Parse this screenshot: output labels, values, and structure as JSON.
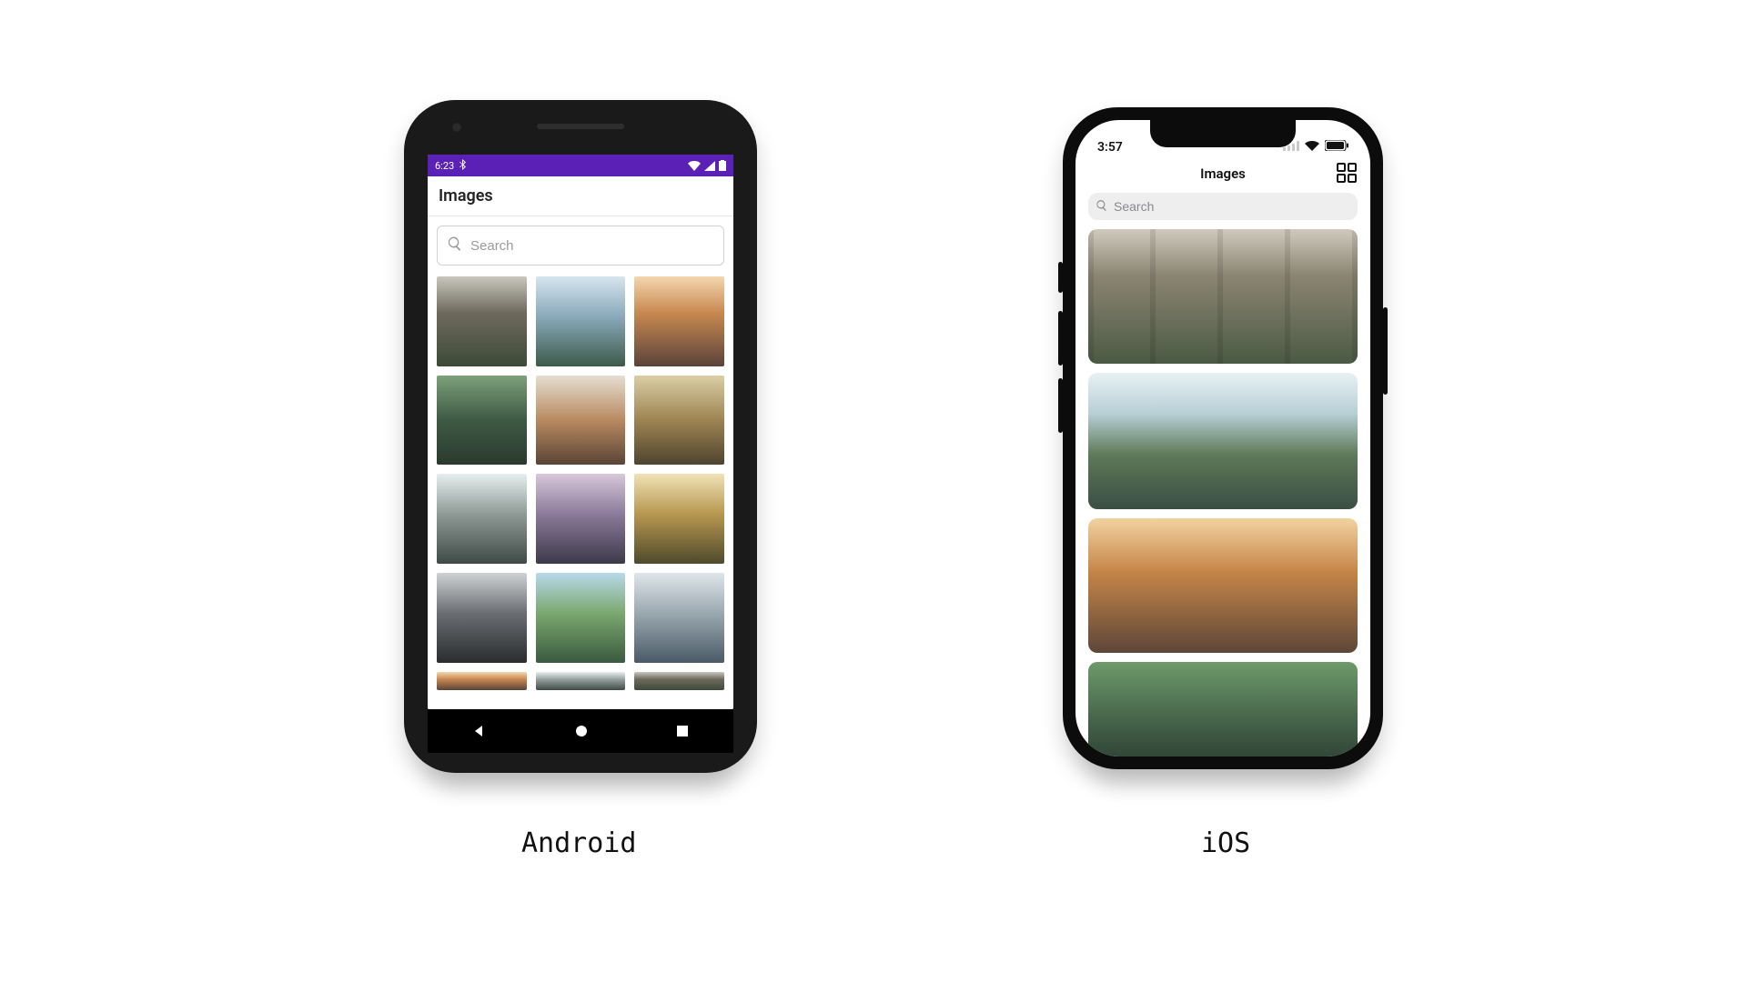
{
  "captions": {
    "android": "Android",
    "ios": "iOS"
  },
  "android": {
    "status": {
      "time": "6:23",
      "icons": {
        "bt": "bt-icon",
        "wifi": "wifi-icon",
        "signal": "signal-icon",
        "battery": "battery-icon"
      }
    },
    "title": "Images",
    "search": {
      "placeholder": "Search",
      "icon": "search-icon"
    },
    "nav": {
      "back": "back-icon",
      "home": "home-icon",
      "recent": "recent-icon"
    },
    "thumbnails_count": 12
  },
  "ios": {
    "status": {
      "time": "3:57",
      "icons": {
        "cell": "cell-icon",
        "wifi": "wifi-icon",
        "battery": "battery-icon"
      }
    },
    "navbar": {
      "title": "Images",
      "right_icon": "grid-icon"
    },
    "search": {
      "placeholder": "Search",
      "icon": "search-icon"
    },
    "list_count": 4
  }
}
